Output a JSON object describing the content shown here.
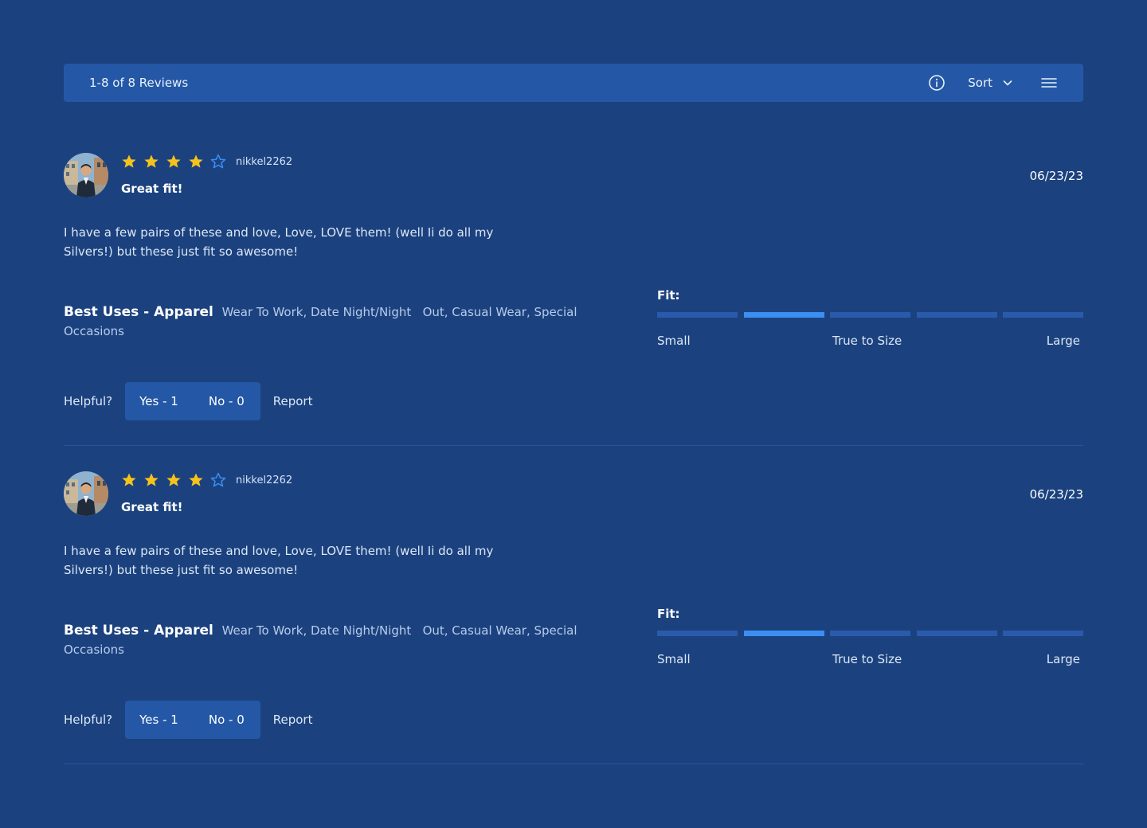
{
  "header": {
    "review_count": "1-8 of 8 Reviews",
    "sort_label": "Sort",
    "icons": [
      "info-icon",
      "chevron-down-icon",
      "menu-icon"
    ]
  },
  "colors": {
    "background": "#1b427f",
    "bar": "#2458a6",
    "star": "#f7c21c",
    "star_empty": "#3d8ef2",
    "fit_active": "#3d8ef2",
    "fit_inactive": "#2a5aab"
  },
  "reviews": [
    {
      "username": "nikkel2262",
      "rating": 4,
      "max_rating": 5,
      "title": "Great fit!",
      "date": "06/23/23",
      "body": "I have a few pairs of these and love, Love, LOVE them! (well Ii do all my Silvers!) but these just fit so awesome!",
      "best_uses_label": "Best Uses - Apparel",
      "best_uses_values": "Wear To Work, Date Night/Night   Out, Casual Wear, Special Occasions",
      "fit": {
        "label": "Fit:",
        "segments": 5,
        "active_segment": 2,
        "scale_left": "Small",
        "scale_mid": "True to Size",
        "scale_right": "Large"
      },
      "helpful": {
        "label": "Helpful?",
        "yes": "Yes - 1",
        "no": "No - 0",
        "report": "Report"
      }
    },
    {
      "username": "nikkel2262",
      "rating": 4,
      "max_rating": 5,
      "title": "Great fit!",
      "date": "06/23/23",
      "body": "I have a few pairs of these and love, Love, LOVE them! (well Ii do all my Silvers!) but these just fit so awesome!",
      "best_uses_label": "Best Uses - Apparel",
      "best_uses_values": "Wear To Work, Date Night/Night   Out, Casual Wear, Special Occasions",
      "fit": {
        "label": "Fit:",
        "segments": 5,
        "active_segment": 2,
        "scale_left": "Small",
        "scale_mid": "True to Size",
        "scale_right": "Large"
      },
      "helpful": {
        "label": "Helpful?",
        "yes": "Yes - 1",
        "no": "No - 0",
        "report": "Report"
      }
    }
  ]
}
